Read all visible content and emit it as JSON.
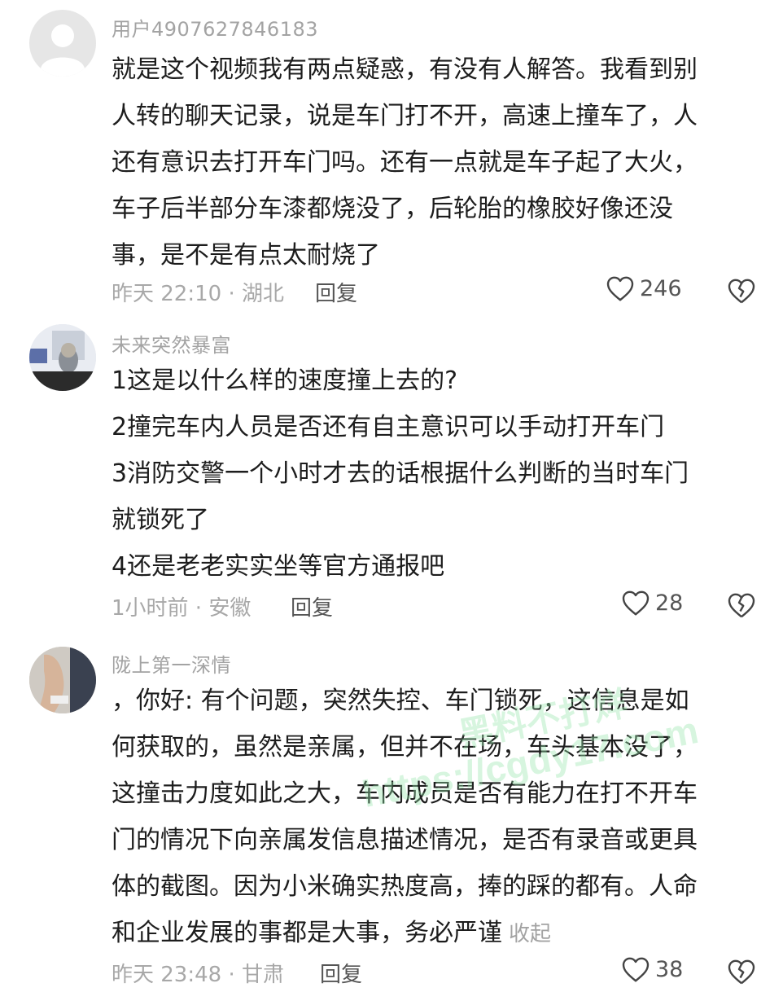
{
  "comments": [
    {
      "username": "用户4907627846183",
      "lines": [
        "就是这个视频我有两点疑惑，有没有人解答。我看到别",
        "人转的聊天记录，说是车门打不开，高速上撞车了，人",
        "还有意识去打开车门吗。还有一点就是车子起了大火，",
        "车子后半部分车漆都烧没了，后轮胎的橡胶好像还没",
        "事，是不是有点太耐烧了"
      ],
      "meta": "昨天 22:10 · 湖北",
      "reply": "回复",
      "likes": "246"
    },
    {
      "username": "未来突然暴富",
      "lines": [
        "1这是以什么样的速度撞上去的?",
        "2撞完车内人员是否还有自主意识可以手动打开车门",
        "3消防交警一个小时才去的话根据什么判断的当时车门",
        "就锁死了",
        "4还是老老实实坐等官方通报吧"
      ],
      "meta": "1小时前 · 安徽",
      "reply": "回复",
      "likes": "28"
    },
    {
      "username": "陇上第一深情",
      "lines": [
        "，你好: 有个问题，突然失控、车门锁死，这信息是如",
        "何获取的，虽然是亲属，但并不在场，车头基本没了，",
        "这撞击力度如此之大，车内成员是否有能力在打不开车",
        "门的情况下向亲属发信息描述情况，是否有录音或更具",
        "体的截图。因为小米确实热度高，捧的踩的都有。人命",
        "和企业发展的事都是大事，务必严谨"
      ],
      "collapse": "收起",
      "meta": "昨天 23:48 · 甘肃",
      "reply": "回复",
      "likes": "38"
    }
  ],
  "watermark": {
    "line1": "黑料不打烊",
    "line2": "https://cgdy17.com"
  }
}
